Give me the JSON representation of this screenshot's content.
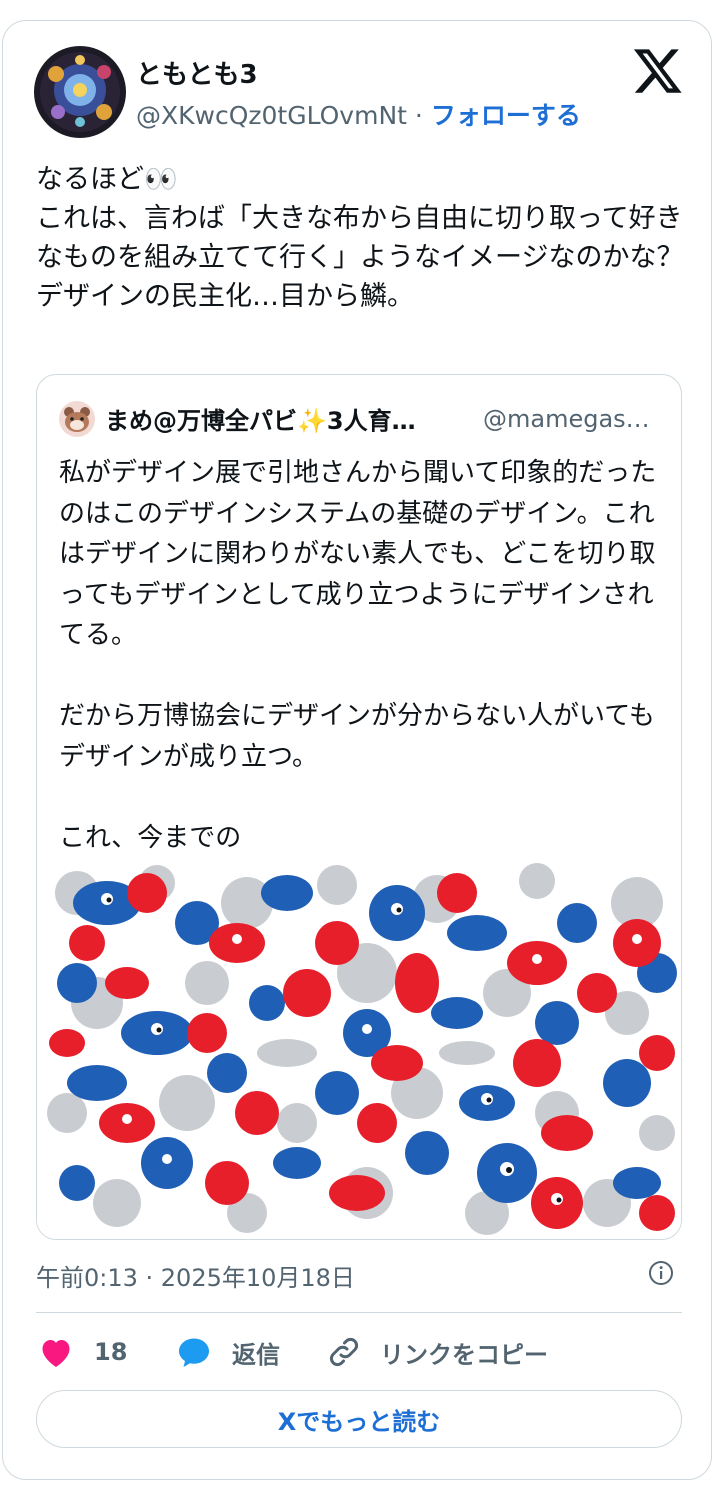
{
  "author": {
    "name": "ともとも3",
    "handle": "@XKwcQz0tGLOvmNt",
    "separator": "·",
    "follow_label": "フォローする"
  },
  "tweet": {
    "text": "なるほど👀\nこれは、言わば「大きな布から自由に切り取って好きなものを組み立てて行く」ようなイメージなのかな？\nデザインの民主化…目から鱗。"
  },
  "quoted": {
    "name": "まめ@万博全パビ✨3人育…",
    "handle": "@mamegas…",
    "text": "私がデザイン展で引地さんから聞いて印象的だったのはこのデザインシステムの基礎のデザイン。これはデザインに関わりがない素人でも、どこを切り取ってもデザインとして成り立つようにデザインされてる。\n\nだから万博協会にデザインが分からない人がいてもデザインが成り立つ。\n\nこれ、今までの"
  },
  "meta": {
    "timestamp": "午前0:13 · 2025年10月18日"
  },
  "actions": {
    "like_count": "18",
    "reply_label": "返信",
    "copy_link_label": "リンクをコピー"
  },
  "read_more_label": "Xでもっと読む",
  "colors": {
    "accent": "#1d6fd6",
    "like": "#f91880",
    "reply": "#1d9bf0",
    "pattern_red": "#e61f2b",
    "pattern_blue": "#1f5fb5",
    "pattern_gray": "#c9ccd1"
  },
  "icons": [
    "x-logo-icon",
    "info-icon",
    "heart-icon",
    "reply-bubble-icon",
    "link-icon"
  ]
}
